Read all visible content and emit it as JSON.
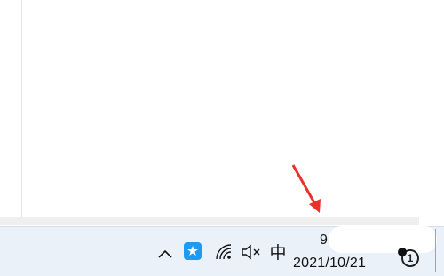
{
  "tray": {
    "time": "9",
    "date": "2021/10/21",
    "ime": "中",
    "icons": [
      "chevron-up-icon",
      "qq-icon",
      "wifi-icon",
      "volume-muted-icon",
      "notification-icon"
    ]
  },
  "colors": {
    "taskbar": "#eaf1f9",
    "accent_arrow": "#e8322a",
    "qq_blue": "#1e9bf0"
  }
}
